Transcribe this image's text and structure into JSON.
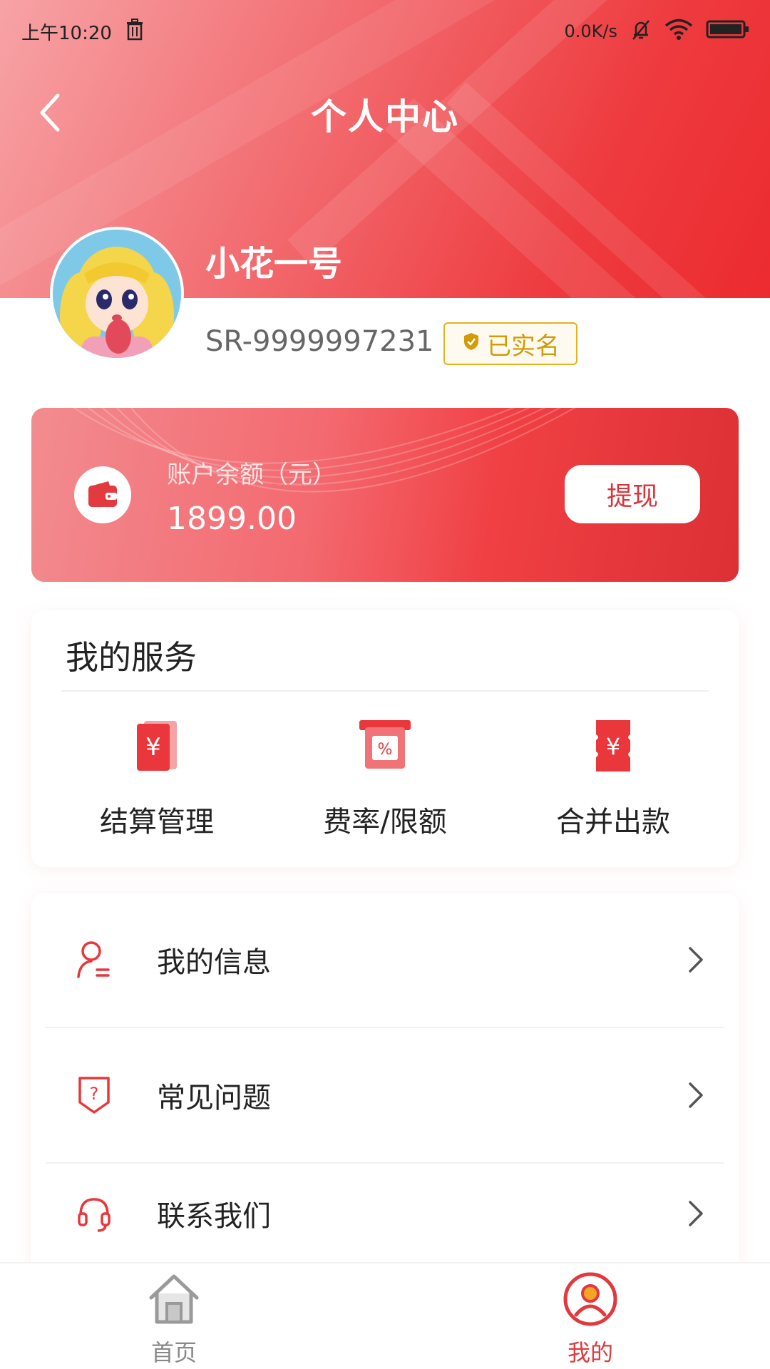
{
  "status_bar": {
    "time": "上午10:20",
    "network_speed": "0.0K/s",
    "icons": [
      "trash-icon",
      "bell-off-icon",
      "wifi-icon",
      "battery-icon"
    ]
  },
  "header": {
    "title": "个人中心",
    "back_icon": "chevron-left-icon"
  },
  "profile": {
    "username": "小花一号",
    "user_id": "SR-9999997231",
    "verified_label": "已实名"
  },
  "balance": {
    "label": "账户余额（元）",
    "value": "1899.00",
    "withdraw_label": "提现"
  },
  "services": {
    "title": "我的服务",
    "items": [
      {
        "label": "结算管理",
        "icon": "yuan-bill-icon"
      },
      {
        "label": "费率/限额",
        "icon": "percent-icon"
      },
      {
        "label": "合并出款",
        "icon": "yuan-ticket-icon"
      }
    ]
  },
  "menu": {
    "items": [
      {
        "label": "我的信息",
        "icon": "user-info-icon"
      },
      {
        "label": "常见问题",
        "icon": "question-shield-icon"
      },
      {
        "label": "联系我们",
        "icon": "headset-icon"
      }
    ]
  },
  "tab_bar": {
    "tabs": [
      {
        "label": "首页",
        "icon": "home-icon",
        "active": false
      },
      {
        "label": "我的",
        "icon": "user-circle-icon",
        "active": true
      }
    ]
  },
  "colors": {
    "brand_red": "#ee3b3f",
    "active_tab": "#e0393e",
    "inactive_tab": "#888888",
    "verified_gold": "#d39b06"
  }
}
